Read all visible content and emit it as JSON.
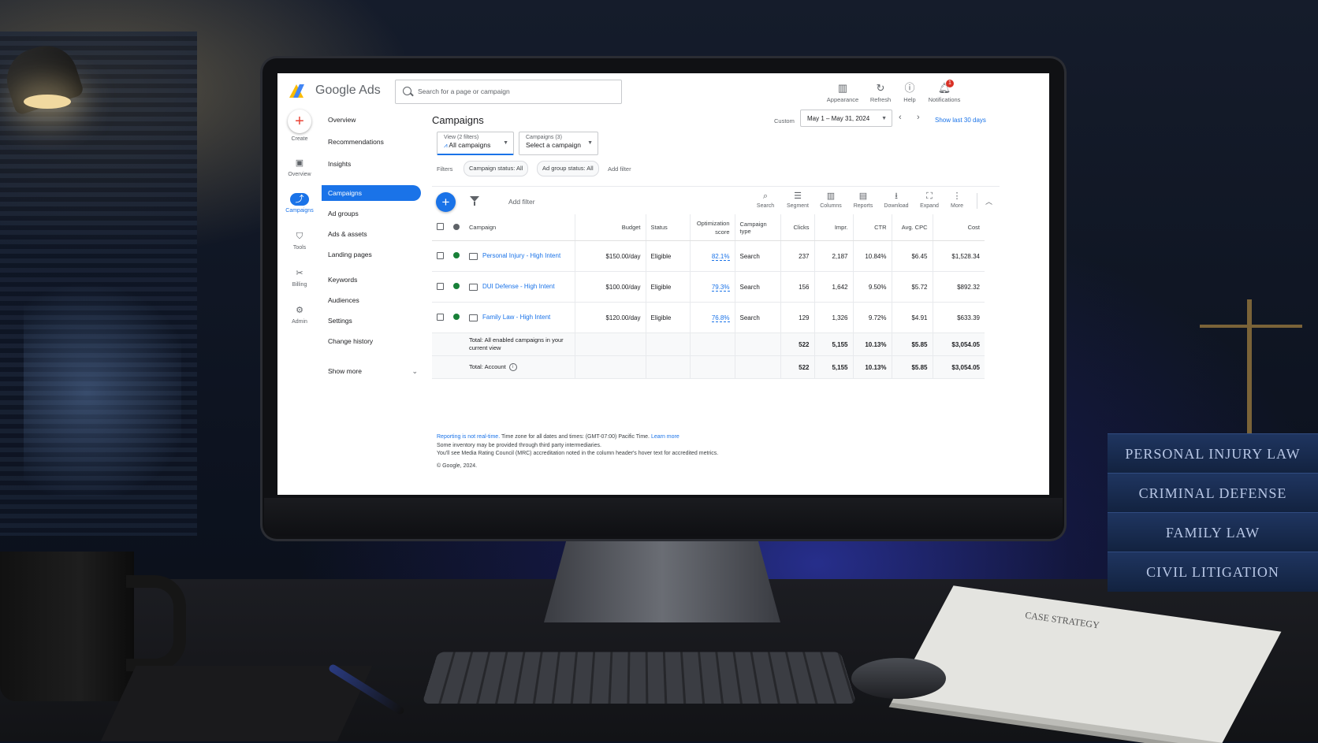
{
  "app": {
    "brand": "Google Ads",
    "search_placeholder": "Search for a page or campaign",
    "top_actions": [
      {
        "label": "Appearance",
        "icon": "appearance-icon"
      },
      {
        "label": "Refresh",
        "icon": "refresh-icon"
      },
      {
        "label": "Help",
        "icon": "help-icon"
      },
      {
        "label": "Notifications",
        "icon": "bell-icon",
        "badge": "1"
      }
    ]
  },
  "rail": [
    {
      "label": "Create",
      "icon": "plus-icon"
    },
    {
      "label": "Overview",
      "icon": "overview-icon"
    },
    {
      "label": "Campaigns",
      "icon": "campaigns-icon",
      "active": true
    },
    {
      "label": "Tools",
      "icon": "tools-icon"
    },
    {
      "label": "Billing",
      "icon": "billing-icon"
    },
    {
      "label": "Admin",
      "icon": "gear-icon"
    }
  ],
  "nav": {
    "items": [
      "Overview",
      "Recommendations",
      "Insights",
      "Campaigns",
      "Ad groups",
      "Ads & assets",
      "Landing pages",
      "Keywords",
      "Audiences",
      "Settings",
      "Change history"
    ],
    "active": "Campaigns",
    "show_more": "Show more"
  },
  "main": {
    "title": "Campaigns",
    "date_label": "Custom",
    "date_range": "May 1 – May 31, 2024",
    "show_last": "Show last 30 days",
    "view_selector": {
      "key": "View (2 filters)",
      "value": "All campaigns"
    },
    "campaign_selector": {
      "key": "Campaigns (3)",
      "value": "Select a campaign"
    },
    "filters_label": "Filters",
    "filter_chips": [
      "Campaign status: All",
      "Ad group status: All"
    ],
    "add_filter": "Add filter",
    "toolbar_add_filter": "Add filter",
    "tools": [
      "Search",
      "Segment",
      "Columns",
      "Reports",
      "Download",
      "Expand",
      "More"
    ]
  },
  "table": {
    "headers": {
      "campaign": "Campaign",
      "budget": "Budget",
      "status": "Status",
      "optimization": "Optimization score",
      "type": "Campaign type",
      "clicks": "Clicks",
      "impr": "Impr.",
      "ctr": "CTR",
      "avgcpc": "Avg. CPC",
      "cost": "Cost"
    },
    "rows": [
      {
        "name": "Personal Injury - High Intent",
        "budget": "$150.00/day",
        "status": "Eligible",
        "opt": "82.1%",
        "type": "Search",
        "clicks": "237",
        "impr": "2,187",
        "ctr": "10.84%",
        "avgcpc": "$6.45",
        "cost": "$1,528.34"
      },
      {
        "name": "DUI Defense - High Intent",
        "budget": "$100.00/day",
        "status": "Eligible",
        "opt": "79.3%",
        "type": "Search",
        "clicks": "156",
        "impr": "1,642",
        "ctr": "9.50%",
        "avgcpc": "$5.72",
        "cost": "$892.32"
      },
      {
        "name": "Family Law - High Intent",
        "budget": "$120.00/day",
        "status": "Eligible",
        "opt": "76.8%",
        "type": "Search",
        "clicks": "129",
        "impr": "1,326",
        "ctr": "9.72%",
        "avgcpc": "$4.91",
        "cost": "$633.39"
      }
    ],
    "totals": [
      {
        "label": "Total: All enabled campaigns in your current view",
        "clicks": "522",
        "impr": "5,155",
        "ctr": "10.13%",
        "avgcpc": "$5.85",
        "cost": "$3,054.05"
      },
      {
        "label": "Total: Account",
        "clicks": "522",
        "impr": "5,155",
        "ctr": "10.13%",
        "avgcpc": "$5.85",
        "cost": "$3,054.05"
      }
    ]
  },
  "footer": {
    "line1_link": "Reporting is not real-time.",
    "line1_text": " Time zone for all dates and times: (GMT-07:00) Pacific Time. ",
    "line1_learn": "Learn more",
    "line2": "Some inventory may be provided through third party intermediaries.",
    "line3": "You'll see Media Rating Council (MRC) accreditation noted in the column header's hover text for accredited metrics.",
    "copyright": "© Google, 2024."
  },
  "scene": {
    "books": [
      "PERSONAL INJURY LAW",
      "CRIMINAL DEFENSE",
      "FAMILY LAW",
      "CIVIL LITIGATION"
    ],
    "paper_title": "CASE STRATEGY"
  }
}
